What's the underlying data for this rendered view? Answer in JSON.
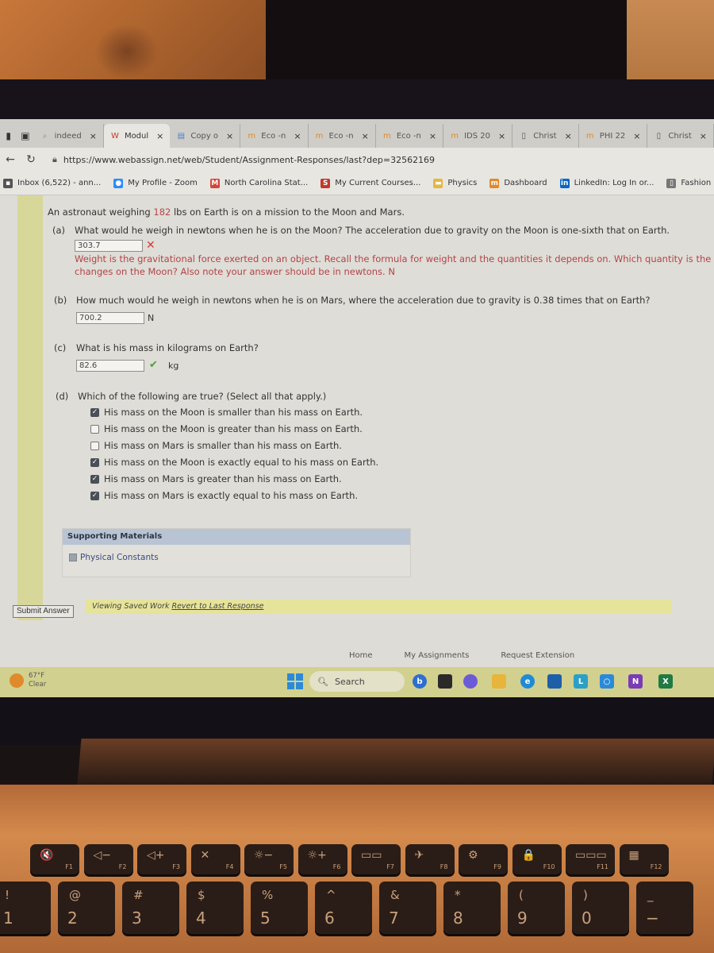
{
  "browser": {
    "tabs": [
      {
        "icon": "search-icon",
        "label": "indeed",
        "active": false
      },
      {
        "icon": "webassign-icon",
        "label": "Modul",
        "active": true
      },
      {
        "icon": "docs-icon",
        "label": "Copy o",
        "active": false
      },
      {
        "icon": "moodle-icon",
        "label": "Eco -n",
        "active": false
      },
      {
        "icon": "moodle-icon",
        "label": "Eco -n",
        "active": false
      },
      {
        "icon": "moodle-icon",
        "label": "Eco -n",
        "active": false
      },
      {
        "icon": "moodle-icon",
        "label": "IDS 20",
        "active": false
      },
      {
        "icon": "page-icon",
        "label": "Christ",
        "active": false
      },
      {
        "icon": "moodle-icon",
        "label": "PHI 22",
        "active": false
      },
      {
        "icon": "page-icon",
        "label": "Christ",
        "active": false
      }
    ],
    "close_glyph": "×",
    "url": "https://www.webassign.net/web/Student/Assignment-Responses/last?dep=32562169",
    "bookmarks": [
      {
        "icon": "mail-icon",
        "label": "Inbox (6,522) - ann..."
      },
      {
        "icon": "zoom-icon",
        "label": "My Profile - Zoom"
      },
      {
        "icon": "gmail-icon",
        "label": "North Carolina Stat..."
      },
      {
        "icon": "courses-icon",
        "label": "My Current Courses..."
      },
      {
        "icon": "folder-icon",
        "label": "Physics"
      },
      {
        "icon": "moodle-icon",
        "label": "Dashboard"
      },
      {
        "icon": "linkedin-icon",
        "label": "LinkedIn: Log In or..."
      },
      {
        "icon": "page-icon",
        "label": "Fashion History"
      }
    ]
  },
  "question": {
    "intro_before": "An astronaut weighing ",
    "intro_highlight": "182",
    "intro_after": " lbs on Earth is on a mission to the Moon and Mars.",
    "parts": {
      "a": {
        "label": "(a)",
        "text": "What would he weigh in newtons when he is on the Moon? The acceleration due to gravity on the Moon is one-sixth that on Earth.",
        "answer": "303.7",
        "status": "incorrect",
        "feedback_line1": "Weight is the gravitational force exerted on an object. Recall the formula for weight and the quantities it depends on. Which quantity is the same o",
        "feedback_line2": "changes on the Moon? Also note your answer should be in newtons. N"
      },
      "b": {
        "label": "(b)",
        "text": "How much would he weigh in newtons when he is on Mars, where the acceleration due to gravity is 0.38 times that on Earth?",
        "answer": "700.2",
        "unit": "N"
      },
      "c": {
        "label": "(c)",
        "text": "What is his mass in kilograms on Earth?",
        "answer": "82.6",
        "status": "correct",
        "unit": "kg"
      },
      "d": {
        "label": "(d)",
        "text": "Which of the following are true? (Select all that apply.)",
        "options": [
          {
            "label": "His mass on the Moon is smaller than his mass on Earth.",
            "checked": true
          },
          {
            "label": "His mass on the Moon is greater than his mass on Earth.",
            "checked": false
          },
          {
            "label": "His mass on Mars is smaller than his mass on Earth.",
            "checked": false
          },
          {
            "label": "His mass on the Moon is exactly equal to his mass on Earth.",
            "checked": true
          },
          {
            "label": "His mass on Mars is greater than his mass on Earth.",
            "checked": true
          },
          {
            "label": "His mass on Mars is exactly equal to his mass on Earth.",
            "checked": true
          }
        ]
      }
    },
    "wrong_glyph": "✕",
    "right_glyph": "✔"
  },
  "supporting": {
    "heading": "Supporting Materials",
    "link": "Physical Constants"
  },
  "actions": {
    "submit": "Submit Answer",
    "saved_text": "Viewing Saved Work ",
    "revert_link": "Revert to Last Response"
  },
  "footer": {
    "home": "Home",
    "assignments": "My Assignments",
    "extension": "Request Extension"
  },
  "taskbar": {
    "temperature": "67°F",
    "condition": "Clear",
    "search": "Search"
  },
  "keyboard": {
    "fkeys": [
      {
        "glyph": "🔇",
        "label": "F1"
      },
      {
        "glyph": "◁−",
        "label": "F2"
      },
      {
        "glyph": "◁+",
        "label": "F3"
      },
      {
        "glyph": "✕",
        "label": "F4"
      },
      {
        "glyph": "☼−",
        "label": "F5"
      },
      {
        "glyph": "☼+",
        "label": "F6"
      },
      {
        "glyph": "▭▭",
        "label": "F7"
      },
      {
        "glyph": "✈",
        "label": "F8"
      },
      {
        "glyph": "⚙",
        "label": "F9"
      },
      {
        "glyph": "🔒",
        "label": "F10"
      },
      {
        "glyph": "▭▭▭",
        "label": "F11"
      },
      {
        "glyph": "▦",
        "label": "F12"
      }
    ],
    "numkeys": [
      {
        "sym": "!",
        "num": "1"
      },
      {
        "sym": "@",
        "num": "2"
      },
      {
        "sym": "#",
        "num": "3"
      },
      {
        "sym": "$",
        "num": "4"
      },
      {
        "sym": "%",
        "num": "5"
      },
      {
        "sym": "^",
        "num": "6"
      },
      {
        "sym": "&",
        "num": "7"
      },
      {
        "sym": "*",
        "num": "8"
      },
      {
        "sym": "(",
        "num": "9"
      },
      {
        "sym": ")",
        "num": "0"
      },
      {
        "sym": "_",
        "num": "−"
      }
    ]
  }
}
